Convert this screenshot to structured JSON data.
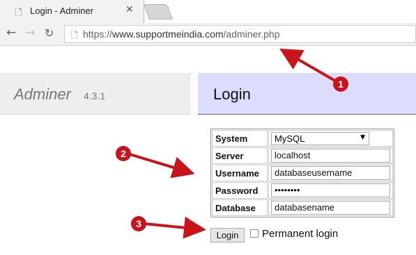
{
  "browser": {
    "tab_title": "Login - Adminer",
    "tab_favicon": "page-icon",
    "close_icon": "close-icon",
    "url_scheme": "https://",
    "url_host": "www.supportmeindia.com",
    "url_path": "/adminer.php"
  },
  "adminer": {
    "brand": "Adminer",
    "version": "4.3.1",
    "heading": "Login"
  },
  "form": {
    "rows": [
      {
        "label": "System",
        "value": "MySQL",
        "type": "select"
      },
      {
        "label": "Server",
        "value": "localhost",
        "type": "text"
      },
      {
        "label": "Username",
        "value": "databaseusername",
        "type": "text"
      },
      {
        "label": "Password",
        "value": "••••••••",
        "type": "password"
      },
      {
        "label": "Database",
        "value": "databasename",
        "type": "text"
      }
    ],
    "submit_label": "Login",
    "permanent_label": "Permanent login",
    "permanent_checked": false
  },
  "annotations": {
    "marker_1": "1",
    "marker_2": "2",
    "marker_3": "3",
    "color": "#c8141a"
  }
}
